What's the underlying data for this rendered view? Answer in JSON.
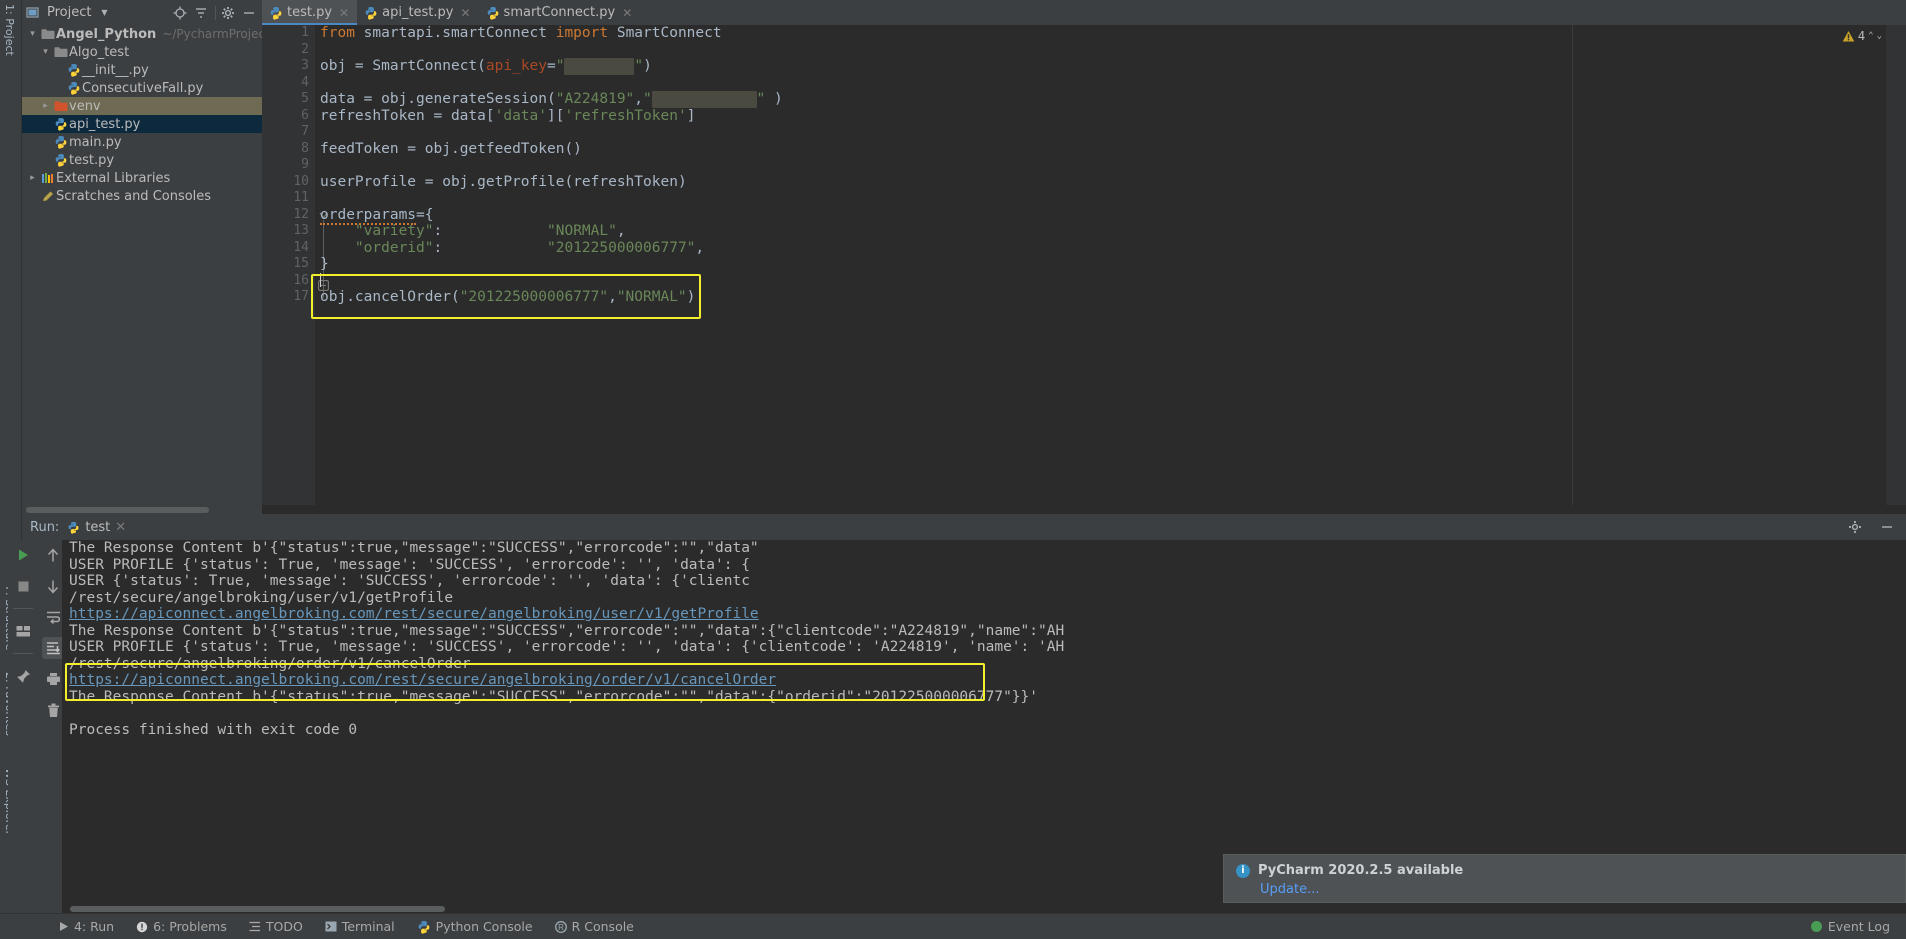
{
  "project_panel": {
    "title": "Project",
    "icons": [
      "locate-icon",
      "collapse-all-icon",
      "gear-icon",
      "hide-icon"
    ],
    "tree": [
      {
        "label": "Angel_Python",
        "path": "~/PycharmProjects/An",
        "icon": "folder-icon",
        "indent": 0,
        "arrow": "expanded",
        "bold": true,
        "state": "normal"
      },
      {
        "label": "Algo_test",
        "path": "",
        "icon": "folder-icon",
        "indent": 1,
        "arrow": "expanded",
        "bold": false,
        "state": "normal"
      },
      {
        "label": "__init__.py",
        "path": "",
        "icon": "python-file-icon",
        "indent": 2,
        "arrow": "none",
        "bold": false,
        "state": "normal"
      },
      {
        "label": "ConsecutiveFall.py",
        "path": "",
        "icon": "python-file-icon",
        "indent": 2,
        "arrow": "none",
        "bold": false,
        "state": "normal"
      },
      {
        "label": "venv",
        "path": "",
        "icon": "folder-orange-icon",
        "indent": 1,
        "arrow": "collapsed",
        "bold": false,
        "state": "hover"
      },
      {
        "label": "api_test.py",
        "path": "",
        "icon": "python-file-icon",
        "indent": 1,
        "arrow": "none",
        "bold": false,
        "state": "selected"
      },
      {
        "label": "main.py",
        "path": "",
        "icon": "python-file-icon",
        "indent": 1,
        "arrow": "none",
        "bold": false,
        "state": "normal"
      },
      {
        "label": "test.py",
        "path": "",
        "icon": "python-file-icon",
        "indent": 1,
        "arrow": "none",
        "bold": false,
        "state": "normal"
      },
      {
        "label": "External Libraries",
        "path": "",
        "icon": "libraries-icon",
        "indent": 0,
        "arrow": "collapsed",
        "bold": false,
        "state": "normal"
      },
      {
        "label": "Scratches and Consoles",
        "path": "",
        "icon": "scratches-icon",
        "indent": 0,
        "arrow": "none",
        "bold": false,
        "state": "normal"
      }
    ]
  },
  "sidebars": {
    "left_top": "1: Project",
    "left_bottom": [
      "7: Structure",
      "2: Favorites",
      "WS Explorer"
    ]
  },
  "editor": {
    "tabs": [
      {
        "label": "test.py",
        "active": true
      },
      {
        "label": "api_test.py",
        "active": false
      },
      {
        "label": "smartConnect.py",
        "active": false
      }
    ],
    "warning_count": "4",
    "gutter_lines": [
      "1",
      "2",
      "3",
      "4",
      "5",
      "6",
      "7",
      "8",
      "9",
      "10",
      "11",
      "12",
      "13",
      "14",
      "15",
      "16",
      "17"
    ],
    "code_lines": [
      "from smartapi.smartConnect import SmartConnect",
      "",
      "obj = SmartConnect(api_key=\"xxxxxxxx\")",
      "",
      "data = obj.generateSession(\"A224819\",\"xxxxxxxxxx\")",
      "refreshToken = data['data']['refreshToken']",
      "",
      "feedToken = obj.getfeedToken()",
      "",
      "userProfile = obj.getProfile(refreshToken)",
      "",
      "orderparams={",
      "    \"variety\":            \"NORMAL\",",
      "    \"orderid\":            \"201225000006777\",",
      "}",
      "",
      "obj.cancelOrder(\"201225000006777\",\"NORMAL\")"
    ],
    "highlight_color": "#f2ef2c"
  },
  "run_panel": {
    "label": "Run:",
    "tab": "test",
    "toolbar_left": [
      "run-icon",
      "stop-icon",
      "layout-icon",
      "pin-icon"
    ],
    "toolbar_right": [
      "up-arrow-icon",
      "down-arrow-icon",
      "soft-wrap-icon",
      "scroll-to-end-icon",
      "print-icon",
      "trash-icon"
    ],
    "console_lines": [
      {
        "text": "The Response Content b'{\"status\":true,\"message\":\"SUCCESS\",\"errorcode\":\"\",\"data\"",
        "link": false,
        "highlight": false
      },
      {
        "text": "USER PROFILE {'status': True, 'message': 'SUCCESS', 'errorcode': '', 'data': {",
        "link": false,
        "highlight": false
      },
      {
        "text": "USER {'status': True, 'message': 'SUCCESS', 'errorcode': '', 'data': {'clientc",
        "link": false,
        "highlight": false
      },
      {
        "text": "/rest/secure/angelbroking/user/v1/getProfile",
        "link": false,
        "highlight": false
      },
      {
        "text": "https://apiconnect.angelbroking.com/rest/secure/angelbroking/user/v1/getProfile",
        "link": true,
        "highlight": false
      },
      {
        "text": "The Response Content b'{\"status\":true,\"message\":\"SUCCESS\",\"errorcode\":\"\",\"data\":{\"clientcode\":\"A224819\",\"name\":\"AH",
        "link": false,
        "highlight": false
      },
      {
        "text": "USER PROFILE {'status': True, 'message': 'SUCCESS', 'errorcode': '', 'data': {'clientcode': 'A224819', 'name': 'AH",
        "link": false,
        "highlight": false
      },
      {
        "text": "/rest/secure/angelbroking/order/v1/cancelOrder",
        "link": false,
        "highlight": false
      },
      {
        "text": "https://apiconnect.angelbroking.com/rest/secure/angelbroking/order/v1/cancelOrder",
        "link": true,
        "highlight": true
      },
      {
        "text": "The Response Content b'{\"status\":true,\"message\":\"SUCCESS\",\"errorcode\":\"\",\"data\":{\"orderid\":\"201225000006777\"}}'",
        "link": false,
        "highlight": true
      },
      {
        "text": "",
        "link": false,
        "highlight": false
      },
      {
        "text": "Process finished with exit code 0",
        "link": false,
        "highlight": false
      }
    ]
  },
  "notification": {
    "title": "PyCharm 2020.2.5 available",
    "action": "Update..."
  },
  "statusbar": {
    "items": [
      {
        "label": "4: Run",
        "icon": "run-icon"
      },
      {
        "label": "6: Problems",
        "icon": "problems-icon"
      },
      {
        "label": "TODO",
        "icon": "todo-icon"
      },
      {
        "label": "Terminal",
        "icon": "terminal-icon"
      },
      {
        "label": "Python Console",
        "icon": "python-console-icon"
      },
      {
        "label": "R Console",
        "icon": "r-console-icon"
      }
    ],
    "event_log": "Event Log"
  }
}
